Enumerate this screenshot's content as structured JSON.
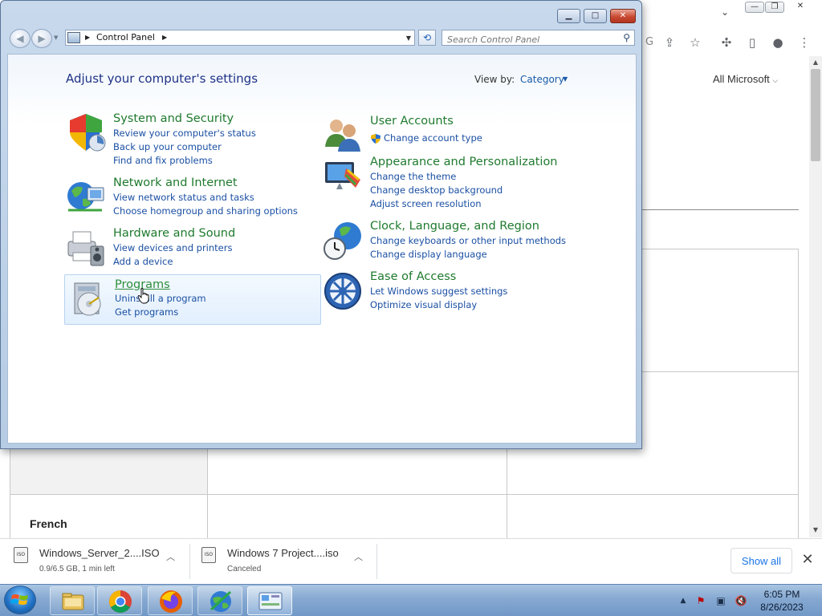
{
  "browser": {
    "all_microsoft": "All Microsoft",
    "row_label": "French"
  },
  "downloads": {
    "items": [
      {
        "name": "Windows_Server_2....ISO",
        "status": "0.9/6.5 GB, 1 min left"
      },
      {
        "name": "Windows 7 Project....iso",
        "status": "Canceled"
      }
    ],
    "show_all": "Show all"
  },
  "control_panel": {
    "address": "Control Panel",
    "search_placeholder": "Search Control Panel",
    "title": "Adjust your computer's settings",
    "view_by_label": "View by:",
    "view_by_value": "Category",
    "categories": [
      {
        "title": "System and Security",
        "icon": "shield-icon",
        "links": [
          "Review your computer's status",
          "Back up your computer",
          "Find and fix problems"
        ]
      },
      {
        "title": "Network and Internet",
        "icon": "globe-network-icon",
        "links": [
          "View network status and tasks",
          "Choose homegroup and sharing options"
        ]
      },
      {
        "title": "Hardware and Sound",
        "icon": "printer-speaker-icon",
        "links": [
          "View devices and printers",
          "Add a device"
        ]
      },
      {
        "title": "Programs",
        "icon": "programs-disc-icon",
        "links": [
          "Uninstall a program",
          "Get programs"
        ]
      },
      {
        "title": "User Accounts",
        "icon": "users-icon",
        "links": [
          "Change account type"
        ]
      },
      {
        "title": "Appearance and Personalization",
        "icon": "monitor-palette-icon",
        "links": [
          "Change the theme",
          "Change desktop background",
          "Adjust screen resolution"
        ]
      },
      {
        "title": "Clock, Language, and Region",
        "icon": "clock-globe-icon",
        "links": [
          "Change keyboards or other input methods",
          "Change display language"
        ]
      },
      {
        "title": "Ease of Access",
        "icon": "ease-of-access-icon",
        "links": [
          "Let Windows suggest settings",
          "Optimize visual display"
        ]
      }
    ]
  },
  "taskbar": {
    "time": "6:05 PM",
    "date": "8/26/2023",
    "apps": [
      "file-explorer-icon",
      "chrome-icon",
      "firefox-icon",
      "network-globe-icon",
      "control-panel-icon"
    ]
  }
}
